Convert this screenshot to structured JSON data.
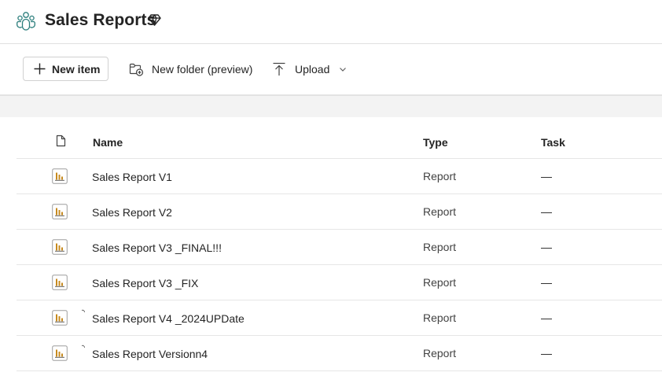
{
  "workspace": {
    "title": "Sales Reports",
    "icon": "workspace-people-icon",
    "badge_icon": "premium-diamond-icon"
  },
  "toolbar": {
    "new_item_label": "New item",
    "new_folder_label": "New folder (preview)",
    "upload_label": "Upload"
  },
  "table": {
    "headers": {
      "name": "Name",
      "type": "Type",
      "task": "Task"
    },
    "rows": [
      {
        "name": "Sales Report V1",
        "type": "Report",
        "task": "—",
        "sync": false
      },
      {
        "name": "Sales Report V2",
        "type": "Report",
        "task": "—",
        "sync": false
      },
      {
        "name": "Sales Report V3 _FINAL!!!",
        "type": "Report",
        "task": "—",
        "sync": false
      },
      {
        "name": "Sales Report V3 _FIX",
        "type": "Report",
        "task": "—",
        "sync": false
      },
      {
        "name": "Sales Report V4 _2024UPDate",
        "type": "Report",
        "task": "—",
        "sync": true
      },
      {
        "name": "Sales Report Versionn4",
        "type": "Report",
        "task": "—",
        "sync": true
      }
    ]
  },
  "colors": {
    "workspace_icon": "#2a7d7b",
    "report_icon_bars": "#c78a1e",
    "border": "#e6e6e6",
    "band": "#f3f3f3"
  }
}
